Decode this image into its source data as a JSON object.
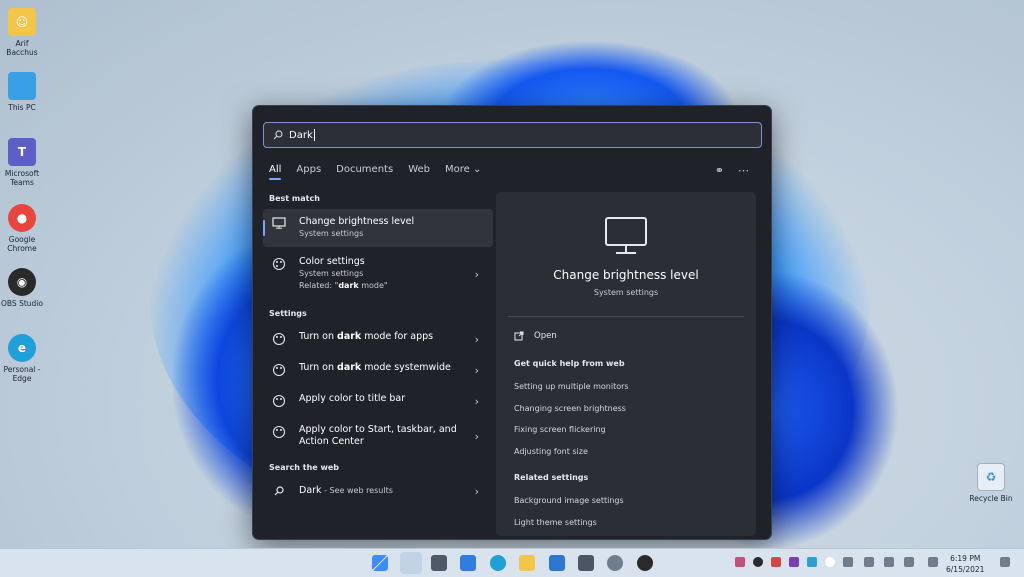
{
  "desktop": {
    "icons": [
      {
        "label": "Arif Bacchus",
        "color": "#f3c64a"
      },
      {
        "label": "This PC",
        "color": "#3aa0e6"
      },
      {
        "label": "Microsoft Teams",
        "color": "#5b5fc7"
      },
      {
        "label": "Google Chrome",
        "color": "#e8453c"
      },
      {
        "label": "OBS Studio",
        "color": "#2a2a2a"
      },
      {
        "label": "Personal - Edge",
        "color": "#1fa0d8"
      }
    ],
    "recycle_bin": "Recycle Bin"
  },
  "search": {
    "value": "Dark"
  },
  "tabs": [
    "All",
    "Apps",
    "Documents",
    "Web",
    "More"
  ],
  "left": {
    "best_match_header": "Best match",
    "best_match": {
      "title": "Change brightness level",
      "subtitle": "System settings"
    },
    "color_settings": {
      "title": "Color settings",
      "subtitle": "System settings",
      "related_prefix": "Related: \"",
      "related_bold": "dark",
      "related_suffix": " mode\""
    },
    "settings_header": "Settings",
    "settings": [
      {
        "pre": "Turn on ",
        "bold": "dark",
        "post": " mode for apps"
      },
      {
        "pre": "Turn on ",
        "bold": "dark",
        "post": " mode systemwide"
      },
      {
        "pre": "Apply color to title bar",
        "bold": "",
        "post": ""
      },
      {
        "pre": "Apply color to Start, taskbar, and Action Center",
        "bold": "",
        "post": ""
      }
    ],
    "web_header": "Search the web",
    "web": {
      "bold": "Dark",
      "post": " - See web results"
    }
  },
  "right": {
    "title": "Change brightness level",
    "subtitle": "System settings",
    "open": "Open",
    "help_header": "Get quick help from web",
    "help_links": [
      "Setting up multiple monitors",
      "Changing screen brightness",
      "Fixing screen flickering",
      "Adjusting font size"
    ],
    "related_header": "Related settings",
    "related_links": [
      "Background image settings",
      "Light theme settings"
    ]
  },
  "taskbar": {
    "time": "6:19 PM",
    "date": "6/15/2021"
  }
}
